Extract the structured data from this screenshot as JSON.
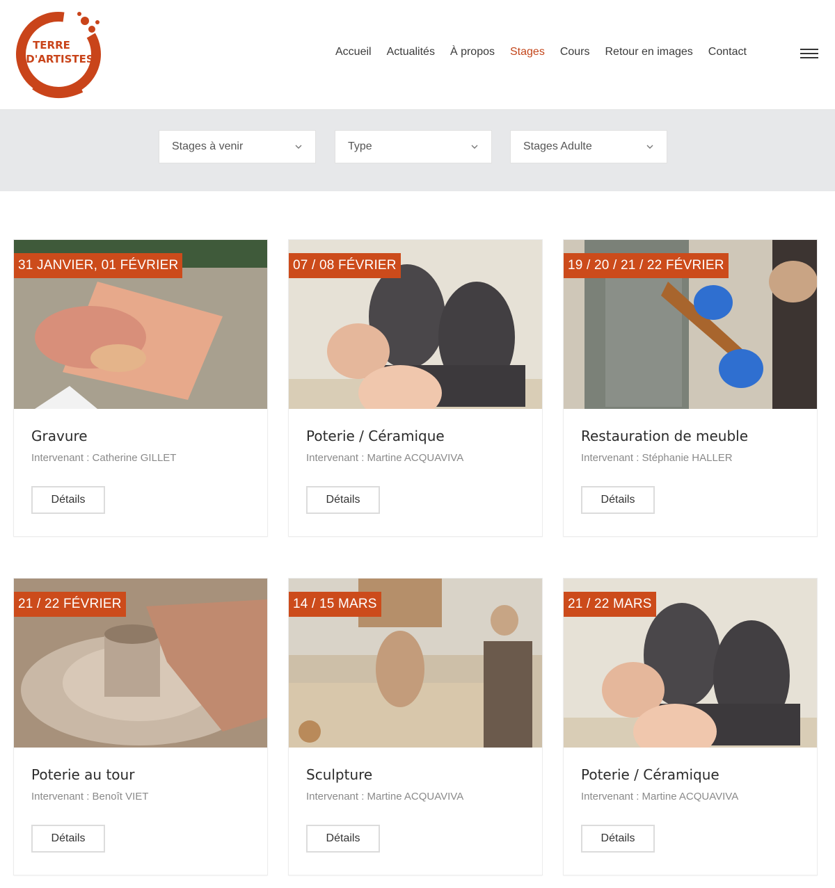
{
  "brand": {
    "logo_text_line1": "TERRE",
    "logo_text_line2": "D'ARTISTES",
    "accent_color": "#cc4b1b"
  },
  "nav": {
    "items": [
      {
        "label": "Accueil",
        "active": false
      },
      {
        "label": "Actualités",
        "active": false
      },
      {
        "label": "À propos",
        "active": false
      },
      {
        "label": "Stages",
        "active": true
      },
      {
        "label": "Cours",
        "active": false
      },
      {
        "label": "Retour en images",
        "active": false
      },
      {
        "label": "Contact",
        "active": false
      }
    ],
    "menu_icon": "hamburger-icon"
  },
  "filters": [
    {
      "value": "Stages à venir",
      "icon": "chevron-down-icon"
    },
    {
      "value": "Type",
      "icon": "chevron-down-icon"
    },
    {
      "value": "Stages Adulte",
      "icon": "chevron-down-icon"
    }
  ],
  "cards": [
    {
      "date": "31 JANVIER, 01 FÉVRIER",
      "title": "Gravure",
      "teacher": "Intervenant : Catherine GILLET",
      "button": "Détails"
    },
    {
      "date": "07 / 08 FÉVRIER",
      "title": "Poterie / Céramique",
      "teacher": "Intervenant : Martine ACQUAVIVA",
      "button": "Détails"
    },
    {
      "date": "19 / 20 / 21 / 22 FÉVRIER",
      "title": "Restauration de meuble",
      "teacher": "Intervenant : Stéphanie HALLER",
      "button": "Détails"
    },
    {
      "date": "21 / 22 FÉVRIER",
      "title": "Poterie au tour",
      "teacher": "Intervenant : Benoît VIET",
      "button": "Détails"
    },
    {
      "date": "14 / 15 MARS",
      "title": "Sculpture",
      "teacher": "Intervenant : Martine ACQUAVIVA",
      "button": "Détails"
    },
    {
      "date": "21 / 22 MARS",
      "title": "Poterie / Céramique",
      "teacher": "Intervenant : Martine ACQUAVIVA",
      "button": "Détails"
    }
  ]
}
